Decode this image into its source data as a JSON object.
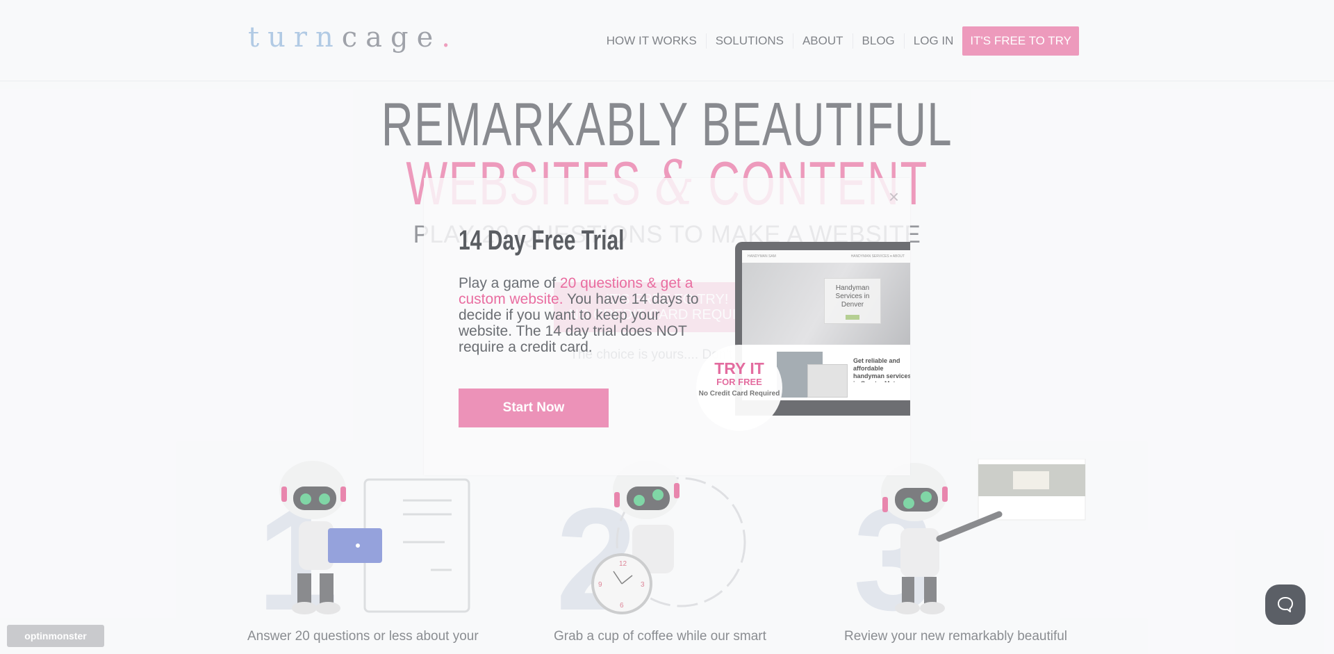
{
  "header": {
    "logo": {
      "part1": "turn",
      "part2": "cage",
      "dot": "."
    },
    "nav": [
      "HOW IT WORKS",
      "SOLUTIONS",
      "ABOUT",
      "BLOG",
      "LOG IN"
    ],
    "cta": "IT'S FREE TO TRY"
  },
  "hero": {
    "line1": "REMARKABLY BEAUTIFUL",
    "line2_a": "WEBSITES",
    "line2_amp": "&",
    "line2_b": "CONTENT",
    "subtitle": "PLAY 20 QUESTIONS TO MAKE A WEBSITE",
    "cta_line1": "IT'S FREE TO TRY!",
    "cta_line2": "NO CREDIT CARD REQUIRED",
    "note": "The choice is yours.... Don't Miss Out!"
  },
  "steps": [
    {
      "number": "1",
      "caption": "Answer 20 questions or less about your"
    },
    {
      "number": "2",
      "caption": "Grab a cup of coffee while our smart"
    },
    {
      "number": "3",
      "caption": "Review your new remarkably beautiful"
    }
  ],
  "popup": {
    "close": "×",
    "title": "14 Day Free Trial",
    "body_plain1": "Play a game of ",
    "body_pink": "20 questions & get a custom website.",
    "body_plain2": " You have 14 days to decide if you want to keep your website. The 14 day trial does NOT require a credit card.",
    "button": "Start Now",
    "mockup": {
      "site_name": "HANDYMAN SAM",
      "site_nav": "HANDYMAN SERVICES ▾   ABOUT",
      "hero_title": "Handyman Services in Denver",
      "section_text": "Get reliable and affordable handyman services in Greater Metro Denver"
    },
    "badge": {
      "line1": "TRY IT",
      "line2": "FOR FREE",
      "line3": "No Credit Card Required"
    }
  },
  "optin_brand": "optinmonster",
  "colors": {
    "brand_pink": "#e673a2",
    "logo_blue": "#94b6da",
    "text_gray": "#5b5e64"
  }
}
